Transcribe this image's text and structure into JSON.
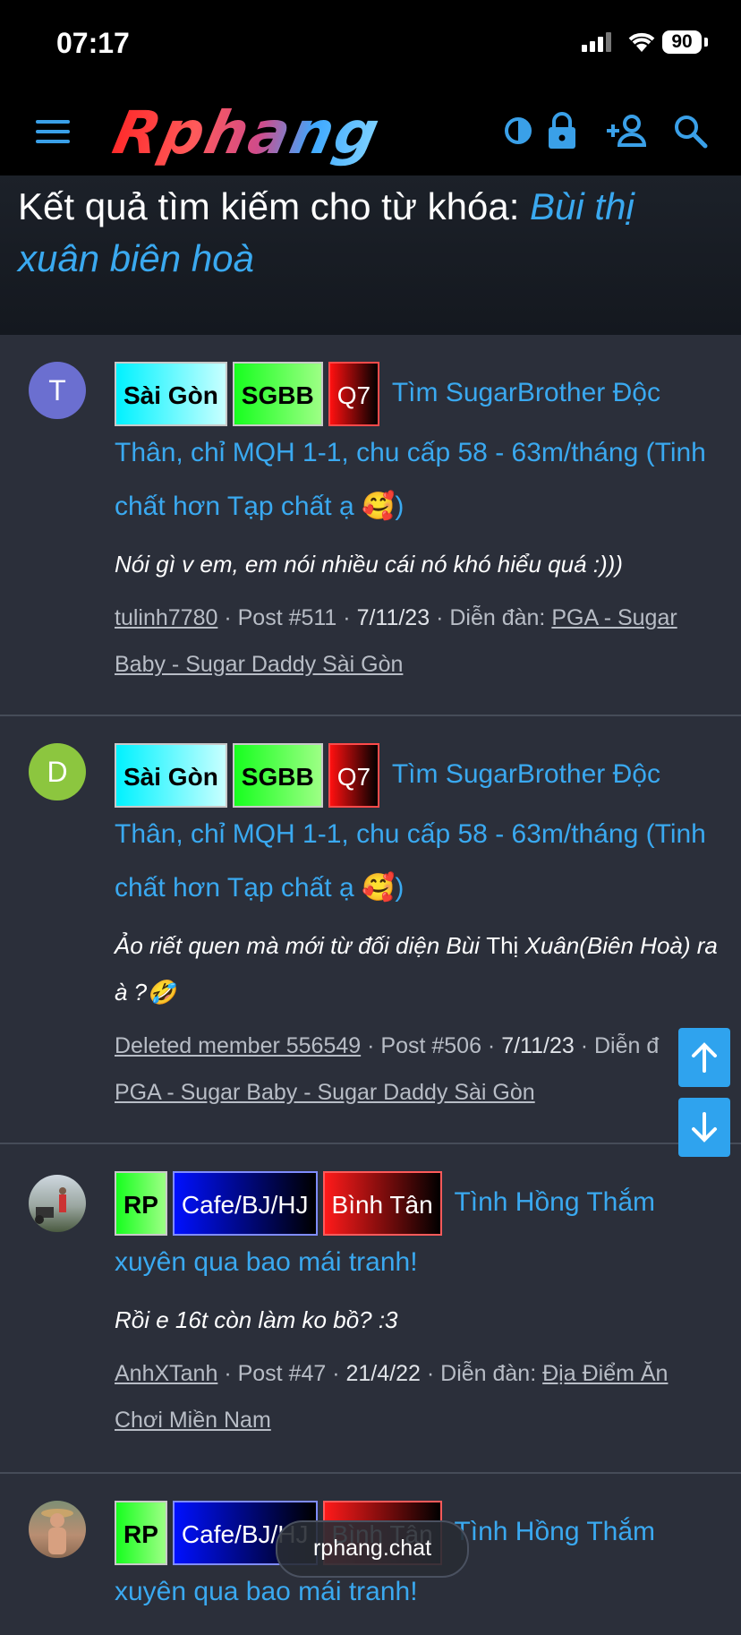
{
  "status": {
    "time": "07:17",
    "battery": "90"
  },
  "nav": {
    "logo": "Rphang"
  },
  "header": {
    "prefix": "Kết quả tìm kiếm cho từ khóa: ",
    "keyword": "Bùi thị xuân biên hoà"
  },
  "results": [
    {
      "avatar_letter": "T",
      "avatar_color": "#6b6fd0",
      "tags": [
        "Sài Gòn",
        "SGBB",
        "Q7"
      ],
      "title": "Tìm SugarBrother Độc Thân, chỉ MQH 1-1, chu cấp 58 - 63m/tháng (Tinh chất hơn Tạp chất ạ 🥰)",
      "snippet": "Nói gì v em, em nói nhiều cái nó khó hiểu quá :)))",
      "author": "tulinh7780",
      "post": "Post #511",
      "date": "7/11/23",
      "forum_label": "Diễn đàn:",
      "forum": "PGA - Sugar Baby - Sugar Daddy Sài Gòn"
    },
    {
      "avatar_letter": "D",
      "avatar_color": "#8cc63f",
      "tags": [
        "Sài Gòn",
        "SGBB",
        "Q7"
      ],
      "title": "Tìm SugarBrother Độc Thân, chỉ MQH 1-1, chu cấp 58 - 63m/tháng (Tinh chất hơn Tạp chất ạ 🥰)",
      "snippet_a": "Ảo riết quen mà mới từ đối diện Bùi ",
      "snippet_b": "Thị",
      "snippet_c": " Xuân(Biên Hoà) ra à ?🤣",
      "author": "Deleted member 556549",
      "post": "Post #506",
      "date": "7/11/23",
      "forum_label": "Diễn đ",
      "forum": "PGA - Sugar Baby - Sugar Daddy Sài Gòn"
    },
    {
      "tags": [
        "RP",
        "Cafe/BJ/HJ",
        "Bình Tân"
      ],
      "title": "Tình Hồng Thắm xuyên qua bao mái tranh!",
      "snippet": "Rồi e 16t còn làm ko bồ? :3",
      "author": "AnhXTanh",
      "post": "Post #47",
      "date": "21/4/22",
      "forum_label": "Diễn đàn:",
      "forum": "Địa Điểm Ăn Chơi Miền Nam"
    },
    {
      "tags": [
        "RP",
        "Cafe/BJ/HJ",
        "Bình Tân"
      ],
      "title": "Tình Hồng Thắm xuyên qua bao mái tranh!"
    }
  ],
  "footer_pill": "rphang.chat"
}
